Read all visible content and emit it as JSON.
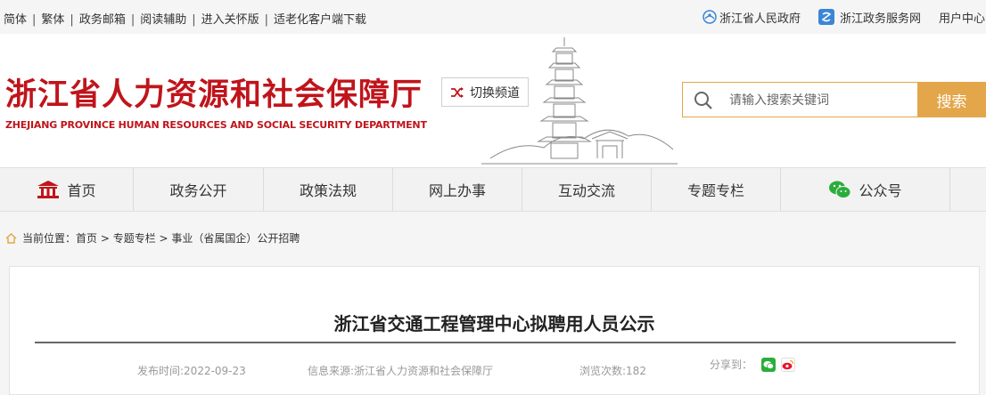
{
  "topbar": {
    "links": [
      "简体",
      "繁体",
      "政务邮箱",
      "阅读辅助",
      "进入关怀版",
      "适老化客户端下载"
    ],
    "right": {
      "gov_site": "浙江省人民政府",
      "service_site": "浙江政务服务网",
      "user_center": "用户中心"
    }
  },
  "header": {
    "title": "浙江省人力资源和社会保障厅",
    "title_en": "ZHEJIANG PROVINCE HUMAN RESOURCES AND SOCIAL SECURITY DEPARTMENT",
    "switch_channel": "切换频道",
    "search": {
      "placeholder": "请输入搜索关键词",
      "button": "搜索"
    }
  },
  "nav": {
    "items": [
      "首页",
      "政务公开",
      "政策法规",
      "网上办事",
      "互动交流",
      "专题专栏",
      "公众号"
    ]
  },
  "breadcrumb": {
    "label": "当前位置：",
    "items": [
      "首页",
      "专题专栏",
      "事业（省属国企）公开招聘"
    ],
    "separator": " > "
  },
  "article": {
    "title": "浙江省交通工程管理中心拟聘用人员公示",
    "publish_time": "发布时间:2022-09-23",
    "source": "信息来源:浙江省人力资源和社会保障厅",
    "views": "浏览次数:182",
    "share_label": "分享到："
  },
  "colors": {
    "brand_red": "#c0141b",
    "search_orange": "#e4a64a",
    "wechat_green": "#2aae3a"
  }
}
